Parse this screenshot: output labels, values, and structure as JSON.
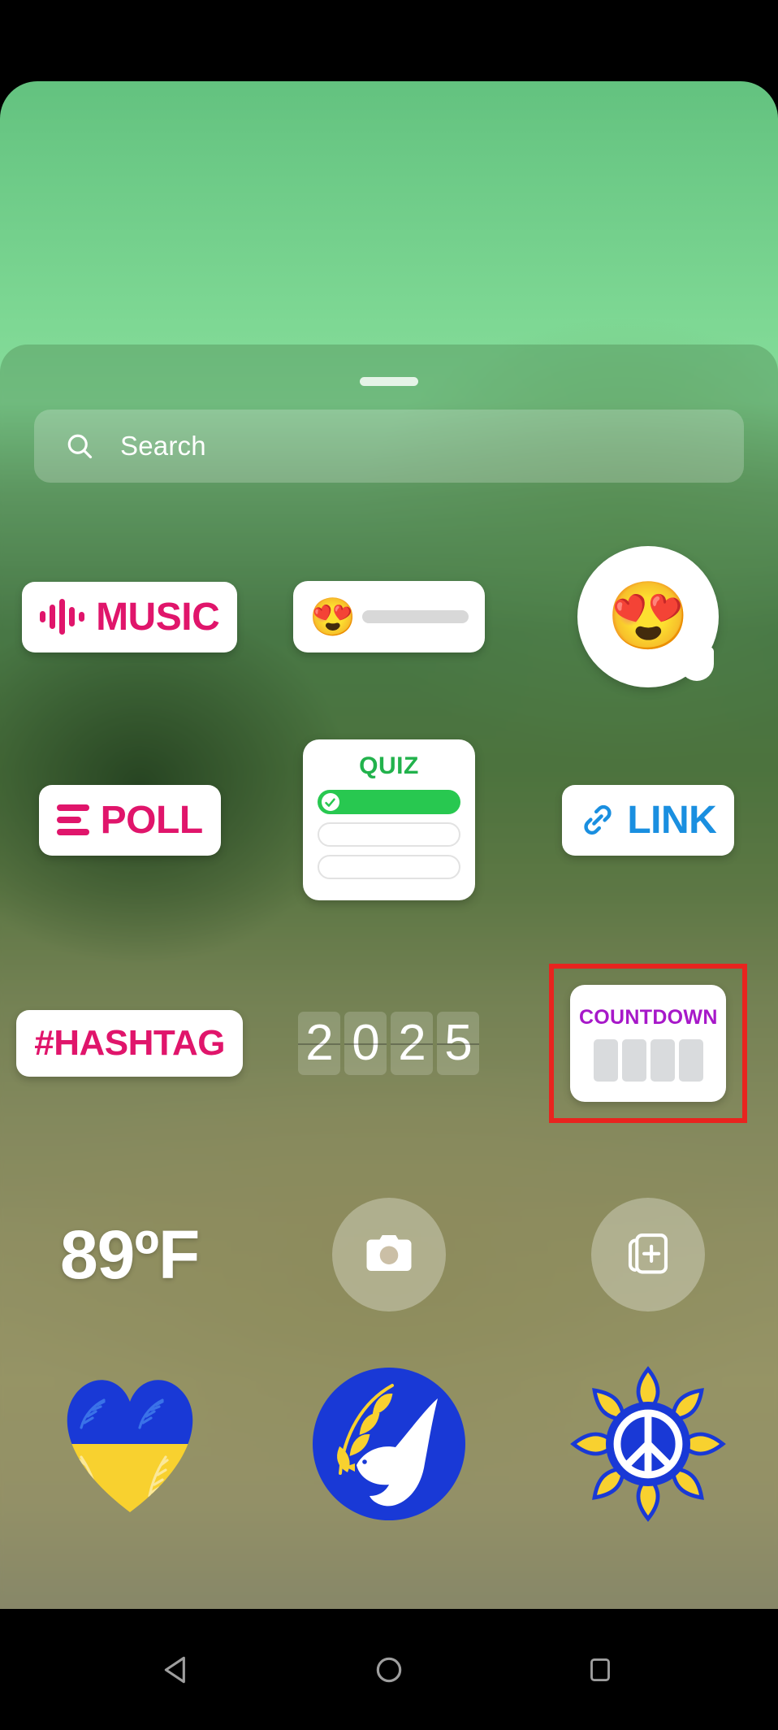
{
  "app": {
    "screen_name": "Instagram Story Sticker Tray"
  },
  "sheet": {
    "drag_handle": "drag-handle"
  },
  "search": {
    "placeholder": "Search",
    "value": "",
    "icon": "search-icon"
  },
  "stickers": {
    "row1": [
      {
        "id": "music",
        "label": "MUSIC",
        "icon": "music-waveform-icon",
        "color": "#e0156b"
      },
      {
        "id": "emoji-slider",
        "label": "",
        "emoji": "😍",
        "icon": "emoji-slider-icon"
      },
      {
        "id": "emoji-reaction",
        "label": "",
        "emoji": "😍",
        "icon": "emoji-reaction-bubble-icon"
      }
    ],
    "row2": [
      {
        "id": "poll",
        "label": "POLL",
        "icon": "poll-bars-icon",
        "color": "#e0156b"
      },
      {
        "id": "quiz",
        "label": "QUIZ",
        "icon": "quiz-card-icon",
        "color": "#22b24c",
        "options": 3,
        "correct_index": 0
      },
      {
        "id": "link",
        "label": "LINK",
        "icon": "chain-link-icon",
        "color": "#1a8fe0"
      }
    ],
    "row3": [
      {
        "id": "hashtag",
        "label": "#HASHTAG",
        "icon": "hashtag-icon",
        "color": "#e0156b"
      },
      {
        "id": "flip-clock",
        "label": "2025",
        "digits": [
          "2",
          "0",
          "2",
          "5"
        ],
        "icon": "flip-clock-icon"
      },
      {
        "id": "countdown",
        "label": "COUNTDOWN",
        "icon": "countdown-icon",
        "color": "#a718c9",
        "highlighted": true,
        "highlight_color": "#e8241f",
        "digit_slots": 4
      }
    ],
    "row4": [
      {
        "id": "temperature",
        "label": "89ºF",
        "icon": "temperature-icon"
      },
      {
        "id": "camera",
        "label": "",
        "icon": "camera-icon"
      },
      {
        "id": "add-photo",
        "label": "",
        "icon": "add-photo-icon"
      }
    ],
    "row5": [
      {
        "id": "ukraine-heart",
        "label": "",
        "icon": "ukraine-heart-sticker-icon"
      },
      {
        "id": "peace-dove",
        "label": "",
        "icon": "peace-dove-sticker-icon"
      },
      {
        "id": "sunflower-peace",
        "label": "",
        "icon": "sunflower-peace-sticker-icon"
      }
    ]
  },
  "navbar": {
    "back": "back-triangle-icon",
    "home": "home-circle-icon",
    "recents": "recents-square-icon"
  },
  "colors": {
    "accent_pink": "#e0156b",
    "accent_blue": "#1a8fe0",
    "accent_green": "#22b24c",
    "accent_purple": "#a718c9",
    "highlight_red": "#e8241f",
    "ukraine_blue": "#1939d6",
    "ukraine_yellow": "#f8d12f"
  }
}
